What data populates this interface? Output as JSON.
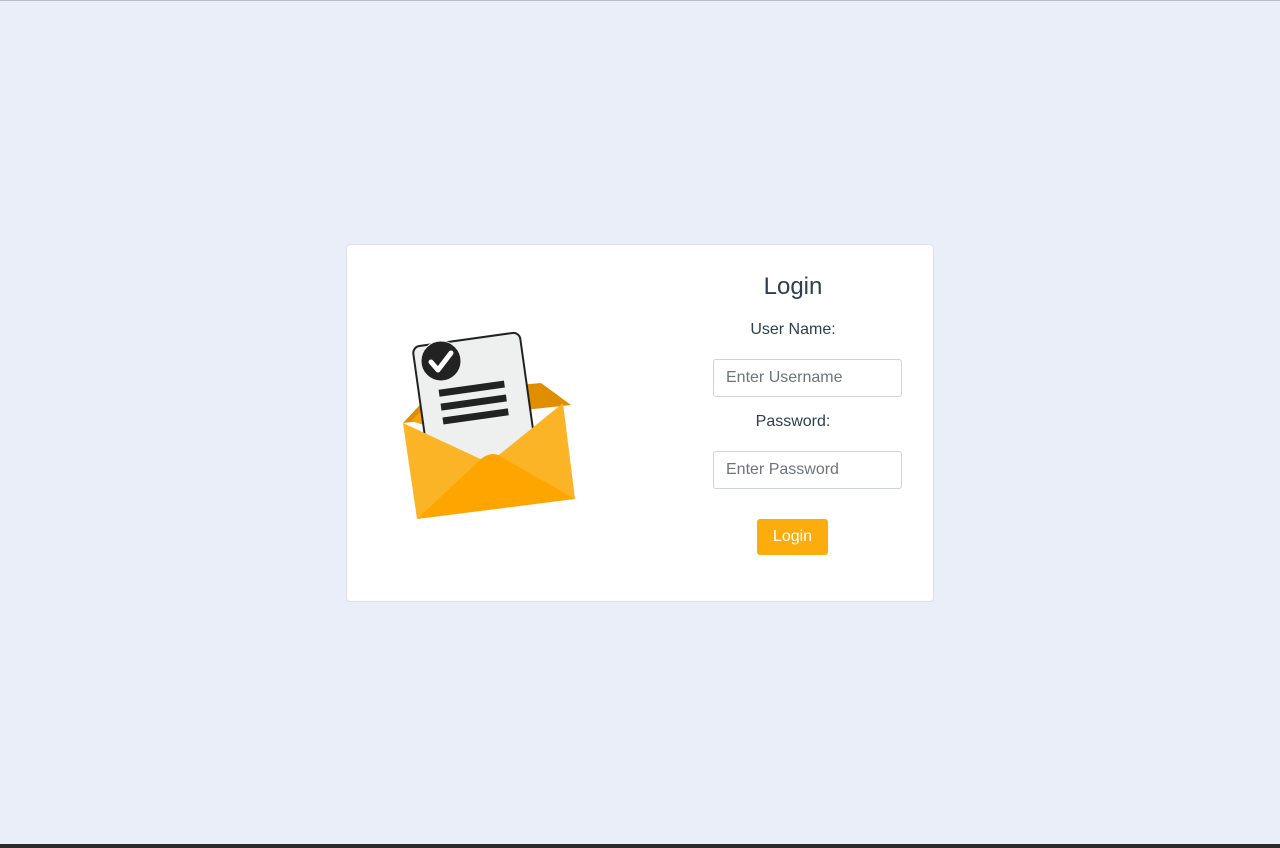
{
  "login": {
    "title": "Login",
    "username_label": "User Name:",
    "username_placeholder": "Enter Username",
    "username_value": "",
    "password_label": "Password:",
    "password_placeholder": "Enter Password",
    "password_value": "",
    "submit_label": "Login"
  },
  "illustration": {
    "icon": "envelope-with-checked-document-icon"
  },
  "colors": {
    "background": "#e9eef8",
    "accent": "#fdac0d",
    "text": "#2c3e50"
  }
}
